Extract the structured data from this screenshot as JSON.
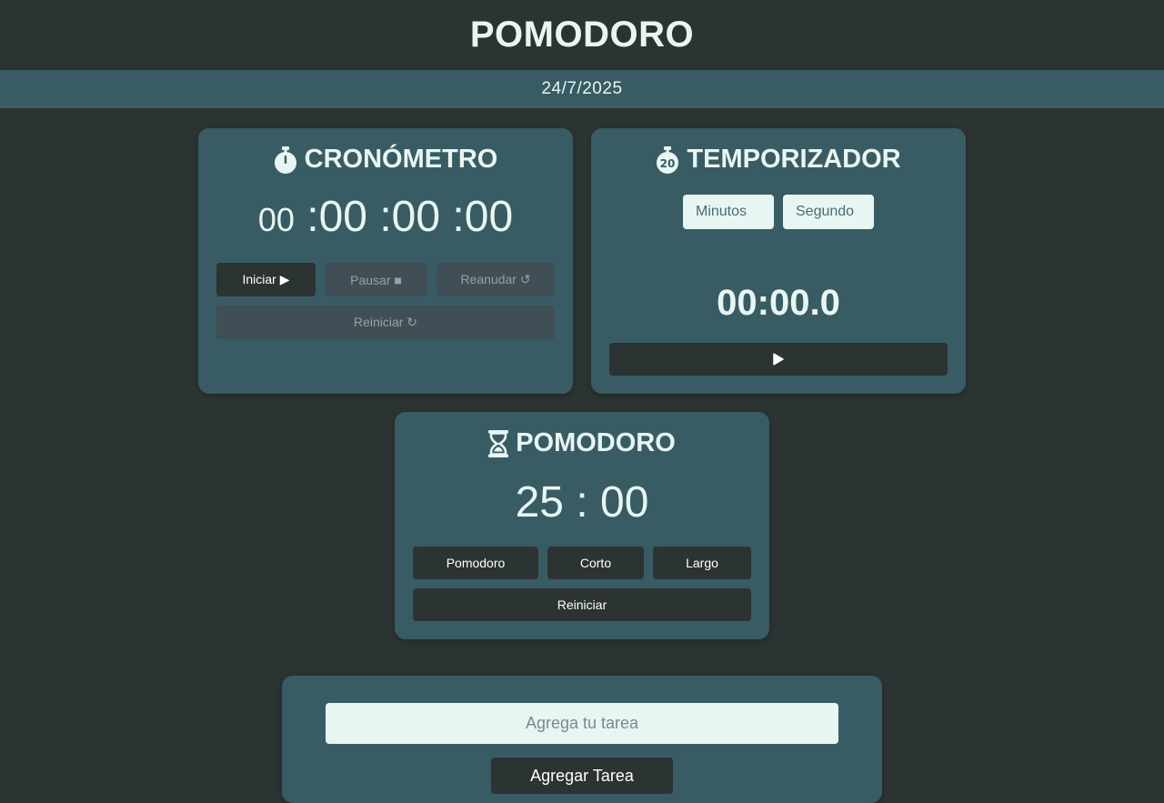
{
  "header": {
    "title": "POMODORO",
    "date": "24/7/2025"
  },
  "stopwatch": {
    "title": "CRONÓMETRO",
    "icon": "stopwatch-icon",
    "display": {
      "hours": "00",
      "minutes": ":00",
      "seconds": ":00",
      "centiseconds": ":00"
    },
    "buttons": {
      "start": "Iniciar ▶",
      "pause": "Pausar ■",
      "resume": "Reanudar ↺",
      "reset": "Reiniciar ↻"
    }
  },
  "timer": {
    "title": "TEMPORIZADOR",
    "icon": "timer-20-icon",
    "minutes_placeholder": "Minutos",
    "seconds_placeholder": "Segundo",
    "display": "00:00.0",
    "play_icon": "play-icon"
  },
  "pomodoro": {
    "title": "POMODORO",
    "icon": "hourglass-icon",
    "display": {
      "minutes": "25",
      "separator": ":",
      "seconds": "00"
    },
    "buttons": {
      "pomodoro": "Pomodoro",
      "short": "Corto",
      "long": "Largo",
      "reset": "Reiniciar"
    }
  },
  "tasks": {
    "input_placeholder": "Agrega tu tarea",
    "add_button": "Agregar Tarea"
  },
  "colors": {
    "background": "#2c3333",
    "card": "#395b64",
    "text": "#e7f6f2",
    "button": "#2c3333",
    "button_disabled": "#3f4f55"
  }
}
